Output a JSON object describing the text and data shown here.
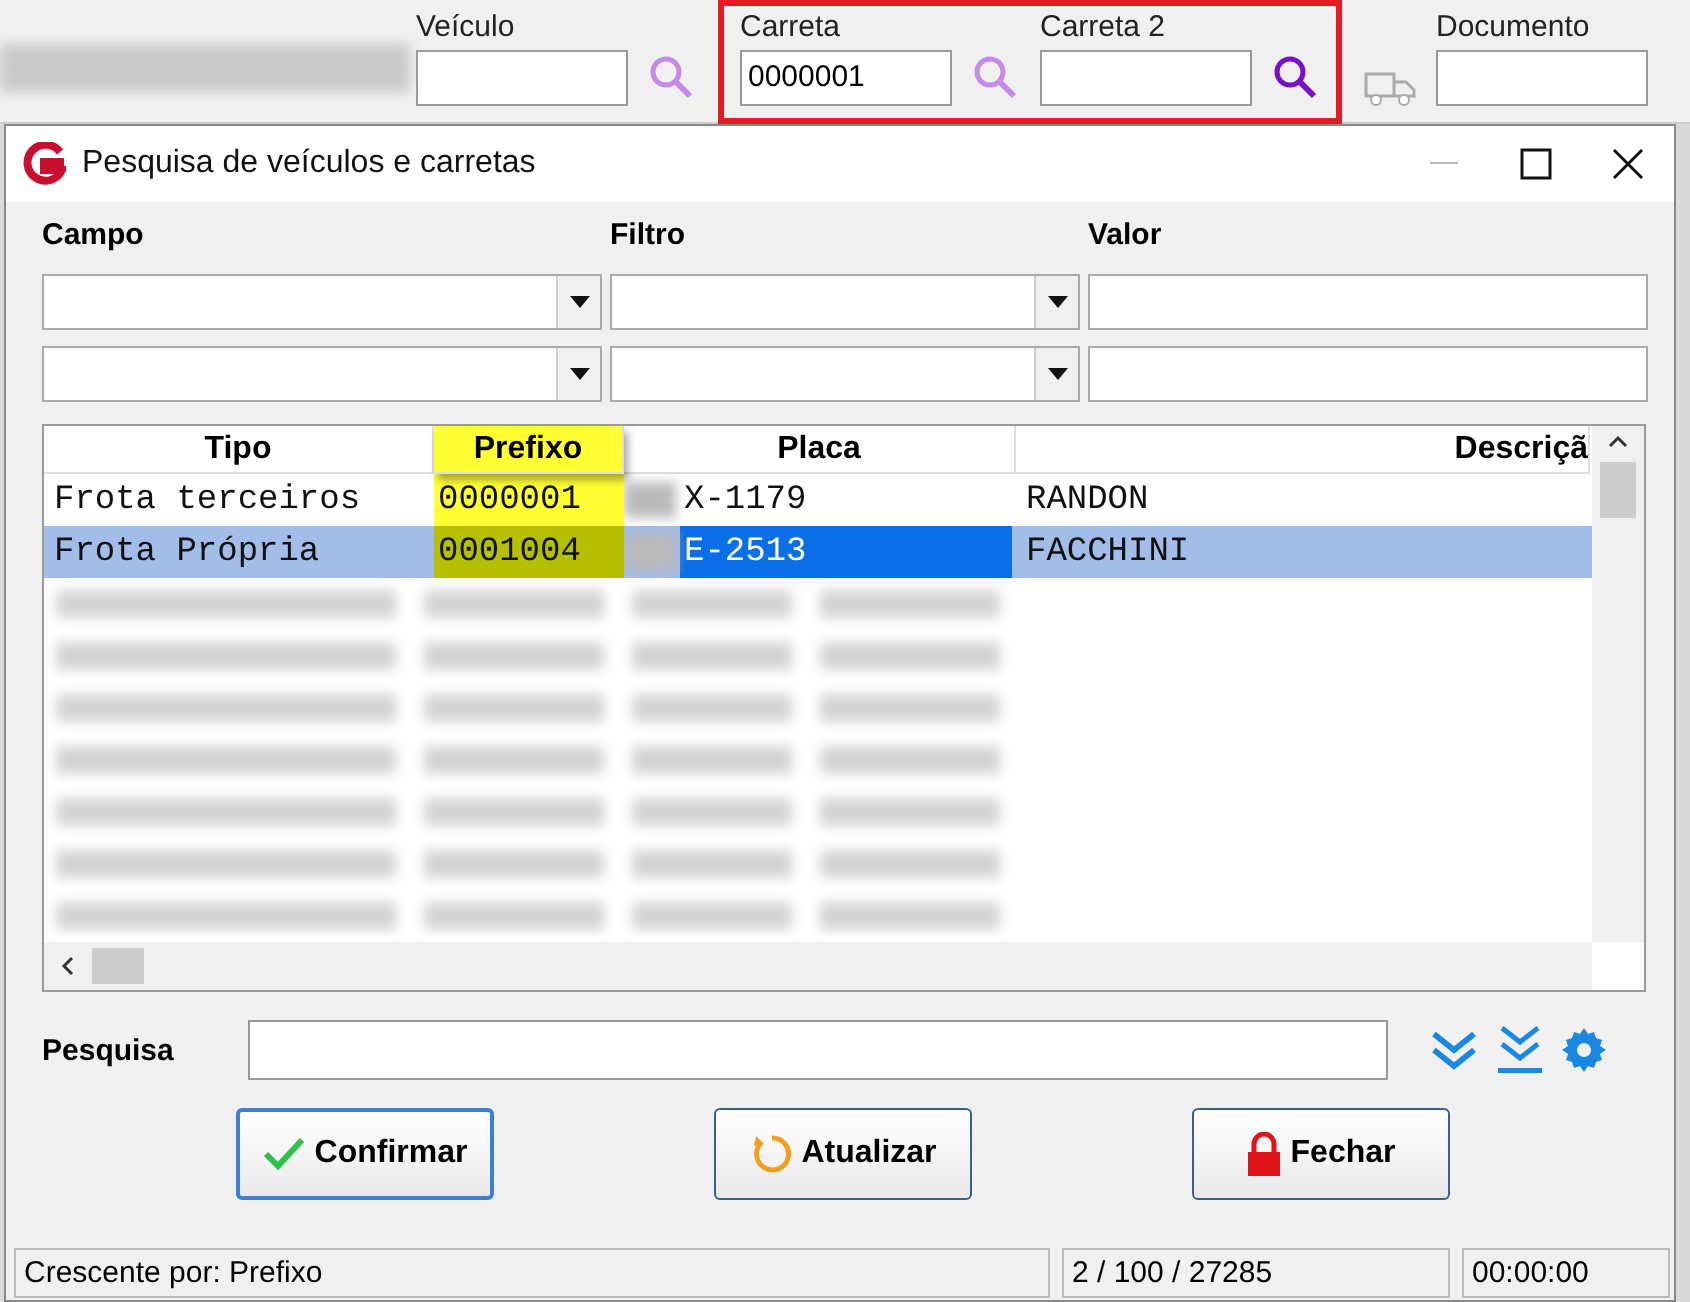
{
  "background_form": {
    "fields": [
      {
        "label": "Veículo",
        "highlighted": false
      },
      {
        "label": "Carreta",
        "value": "0000001",
        "highlighted": true
      },
      {
        "label": "Carreta 2",
        "highlighted": true
      },
      {
        "label": "Documento",
        "highlighted": false
      }
    ]
  },
  "dialog": {
    "title": "Pesquisa de veículos e carretas"
  },
  "filter_headers": [
    "Campo",
    "Filtro",
    "Valor"
  ],
  "table": {
    "columns": [
      {
        "label": "Tipo",
        "sorted": false
      },
      {
        "label": "Prefixo",
        "sorted": true
      },
      {
        "label": "Placa",
        "sorted": false
      },
      {
        "label": "Descriçã",
        "sorted": false
      }
    ],
    "rows": [
      {
        "cells": [
          "Frota terceiros",
          "0000001",
          "X-1179",
          "RANDON"
        ],
        "selected": false
      },
      {
        "cells": [
          "Frota Própria",
          "0001004",
          "E-2513",
          "FACCHINI"
        ],
        "selected": true
      }
    ]
  },
  "search": {
    "label": "Pesquisa"
  },
  "buttons": [
    {
      "label": "Confirmar",
      "kind": "confirm",
      "focused": true
    },
    {
      "label": "Atualizar",
      "kind": "refresh",
      "focused": false
    },
    {
      "label": "Fechar",
      "kind": "close",
      "focused": false
    }
  ],
  "status_bar": [
    "Crescente por: Prefixo",
    "2 / 100 / 27285",
    "00:00:00"
  ]
}
